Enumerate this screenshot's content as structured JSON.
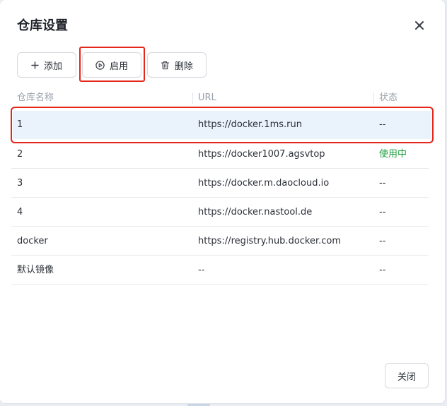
{
  "dialog": {
    "title": "仓库设置",
    "close_icon": "close-icon"
  },
  "toolbar": {
    "add_label": "添加",
    "enable_label": "启用",
    "delete_label": "删除"
  },
  "table": {
    "headers": [
      "仓库名称",
      "URL",
      "状态"
    ],
    "rows": [
      {
        "name": "1",
        "url": "https://docker.1ms.run",
        "status": "--",
        "selected": true
      },
      {
        "name": "2",
        "url": "https://docker1007.agsvtop",
        "status": "使用中",
        "selected": false
      },
      {
        "name": "3",
        "url": "https://docker.m.daocloud.io",
        "status": "--",
        "selected": false
      },
      {
        "name": "4",
        "url": "https://docker.nastool.de",
        "status": "--",
        "selected": false
      },
      {
        "name": "docker",
        "url": "https://registry.hub.docker.com",
        "status": "--",
        "selected": false
      },
      {
        "name": "默认镜像",
        "url": "--",
        "status": "--",
        "selected": false
      }
    ]
  },
  "footer": {
    "close_label": "关闭"
  },
  "colors": {
    "active_status": "#1a9d3c",
    "selected_row": "#eaf2fc",
    "highlight": "#e5261b"
  }
}
